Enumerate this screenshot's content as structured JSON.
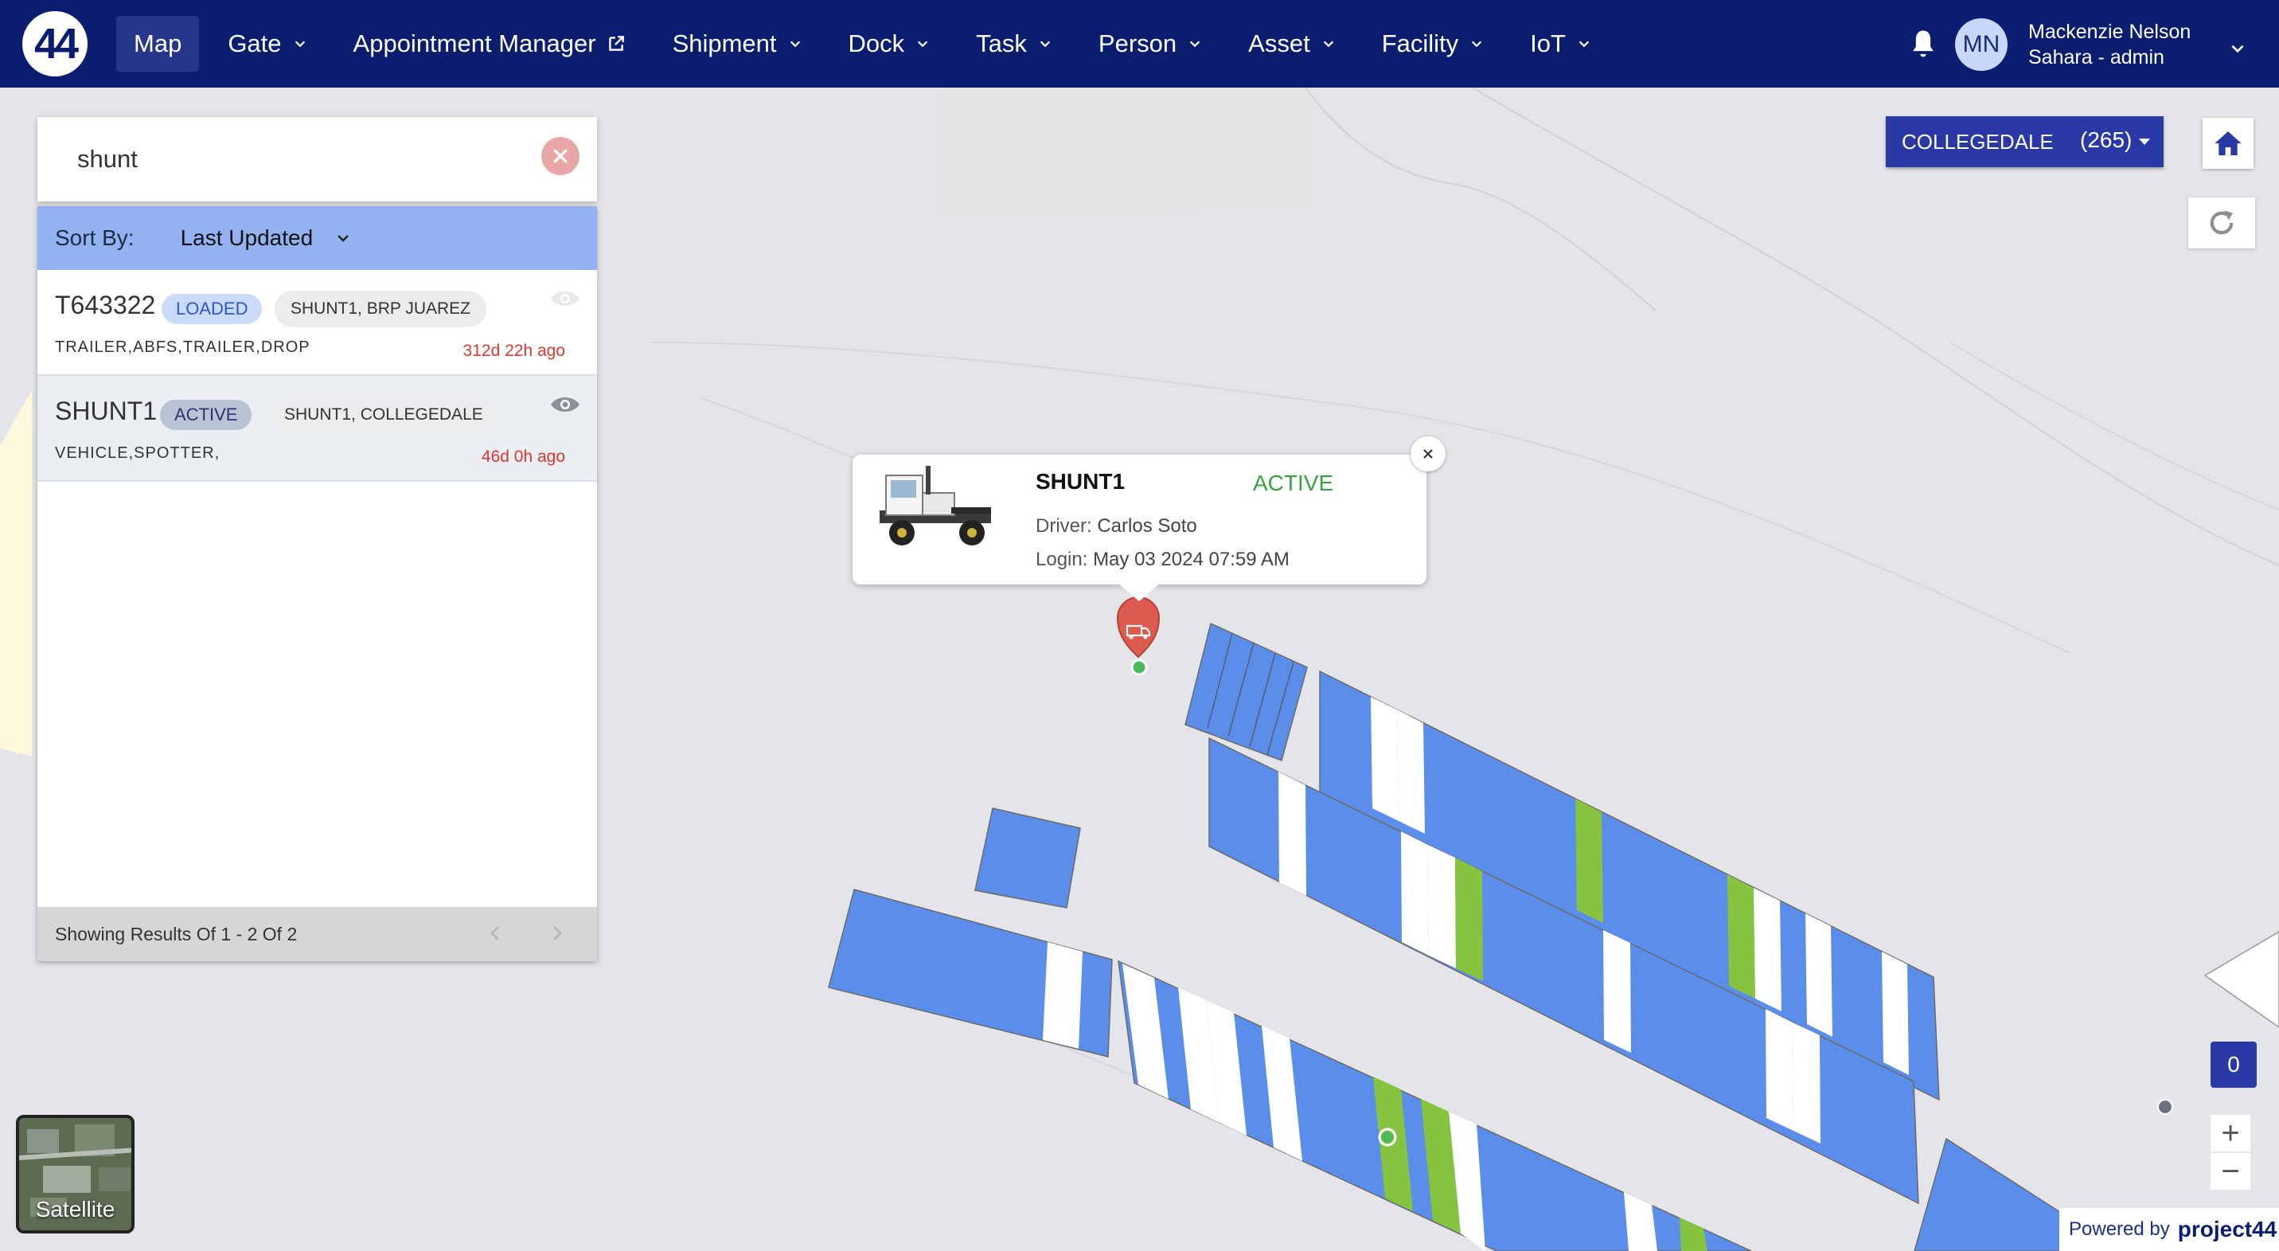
{
  "nav": {
    "logo_text": "44",
    "items": [
      {
        "label": "Map",
        "active": true,
        "dropdown": false
      },
      {
        "label": "Gate",
        "dropdown": true
      },
      {
        "label": "Appointment Manager",
        "external": true
      },
      {
        "label": "Shipment",
        "dropdown": true
      },
      {
        "label": "Dock",
        "dropdown": true
      },
      {
        "label": "Task",
        "dropdown": true
      },
      {
        "label": "Person",
        "dropdown": true
      },
      {
        "label": "Asset",
        "dropdown": true
      },
      {
        "label": "Facility",
        "dropdown": true
      },
      {
        "label": "IoT",
        "dropdown": true
      }
    ],
    "user": {
      "initials": "MN",
      "name": "Mackenzie Nelson",
      "role": "Sahara - admin"
    }
  },
  "search": {
    "value": "shunt"
  },
  "sort": {
    "label": "Sort By:",
    "value": "Last Updated"
  },
  "results": [
    {
      "id": "T643322",
      "status": "LOADED",
      "tag_primary": "SHUNT1",
      "tag_secondary": "BRP JUAREZ",
      "sub": "TRAILER,ABFS,TRAILER,DROP",
      "time": "312d 22h ago"
    },
    {
      "id": "SHUNT1",
      "status": "ACTIVE",
      "tag_primary": "SHUNT1",
      "tag_secondary": "COLLEGEDALE",
      "sub": "VEHICLE,SPOTTER,",
      "time": "46d 0h ago"
    }
  ],
  "pagination": {
    "text": "Showing Results Of 1 - 2 Of 2"
  },
  "popup": {
    "name": "SHUNT1",
    "status": "ACTIVE",
    "driver_label": "Driver:",
    "driver": "Carlos Soto",
    "login_label": "Login:",
    "login": "May 03 2024 07:59 AM"
  },
  "facility": {
    "name": "COLLEGEDALE",
    "count": "(265)"
  },
  "map_controls": {
    "count": "0",
    "zoom_in": "+",
    "zoom_out": "−",
    "satellite_label": "Satellite"
  },
  "footer": {
    "powered_by": "Powered by",
    "brand": "project44"
  },
  "colors": {
    "nav_bg": "#0b1d6f",
    "slot_blue": "#5b8dea",
    "slot_green": "#86c440",
    "slot_white": "#ffffff",
    "accent": "#2b39a6",
    "alert_red": "#d63a2e"
  },
  "icons": [
    "bell-icon",
    "chevron-down-icon",
    "external-link-icon",
    "close-icon",
    "eye-icon",
    "home-icon",
    "refresh-icon",
    "truck-pin-icon"
  ]
}
